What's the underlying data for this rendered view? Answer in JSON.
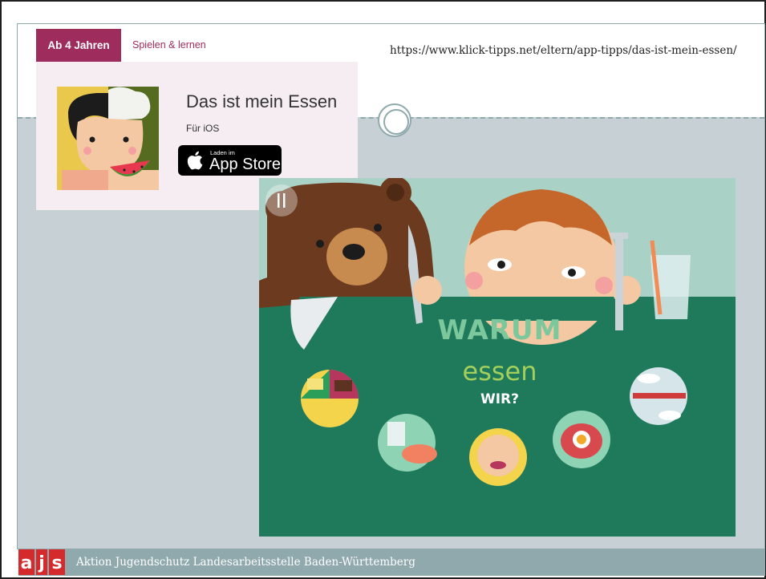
{
  "source_url": "https://www.klick-tipps.net/eltern/app-tipps/das-ist-mein-essen/",
  "card": {
    "tab_age": "Ab 4 Jahren",
    "tab_category": "Spielen & lernen",
    "app_title": "Das ist mein Essen",
    "platform": "Für iOS",
    "badge_small": "Laden im",
    "badge_big": "App Store"
  },
  "game": {
    "title_line1": "WARUM",
    "title_line2": "essen",
    "title_line3": "WIR?",
    "menu_icon": "fork-knife-icon"
  },
  "footer": {
    "logo_text": "ajs",
    "organization": "Aktion Jugendschutz Landesarbeitsstelle Baden-Württemberg"
  },
  "colors": {
    "tab_accent": "#9e2c5c",
    "card_bg": "#f5edf1",
    "frame_bg": "#c7d1d5",
    "frame_line": "#8fa9ad",
    "table_green": "#1f7a5c",
    "logo_red": "#d42a2c"
  }
}
